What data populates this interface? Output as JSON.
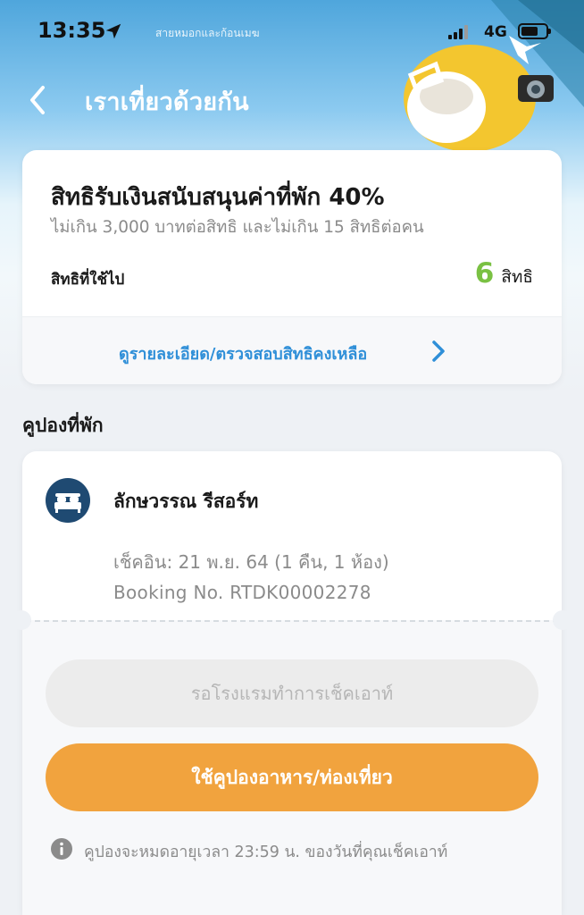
{
  "status_bar": {
    "time": "13:35",
    "ticker": "สายหมอกและก้อนเมฆ",
    "network": "4G"
  },
  "header": {
    "title": "เราเที่ยวด้วยกัน"
  },
  "entitlement": {
    "title": "สิทธิรับเงินสนับสนุนค่าที่พัก 40%",
    "subtitle": "ไม่เกิน 3,000 บาทต่อสิทธิ และไม่เกิน 15 สิทธิต่อคน",
    "used_label": "สิทธิที่ใช้ไป",
    "used_count": "6",
    "used_unit": "สิทธิ",
    "details_link": "ดูรายละเอียด/ตรวจสอบสิทธิคงเหลือ"
  },
  "section": {
    "title": "คูปองที่พัก"
  },
  "coupon": {
    "hotel_name": "ลักษวรรณ รีสอร์ท",
    "checkin": "เช็คอิน: 21 พ.ย. 64 (1 คืน, 1 ห้อง)",
    "booking": "Booking No. RTDK00002278",
    "status_button": "รอโรงแรมทำการเช็คเอาท์",
    "action_button": "ใช้คูปองอาหาร/ท่องเที่ยว",
    "note": "คูปองจะหมดอายุเวลา 23:59 น. ของวันที่คุณเช็คเอาท์"
  },
  "colors": {
    "accent_blue": "#2f8fd8",
    "count_green": "#7ac143",
    "primary_orange": "#f1a33e",
    "avatar_navy": "#1f4a72"
  },
  "icons": {
    "back": "chevron-left-icon",
    "location": "location-arrow-icon",
    "details": "chevron-right-icon",
    "hotel": "bed-icon",
    "info": "info-icon"
  }
}
